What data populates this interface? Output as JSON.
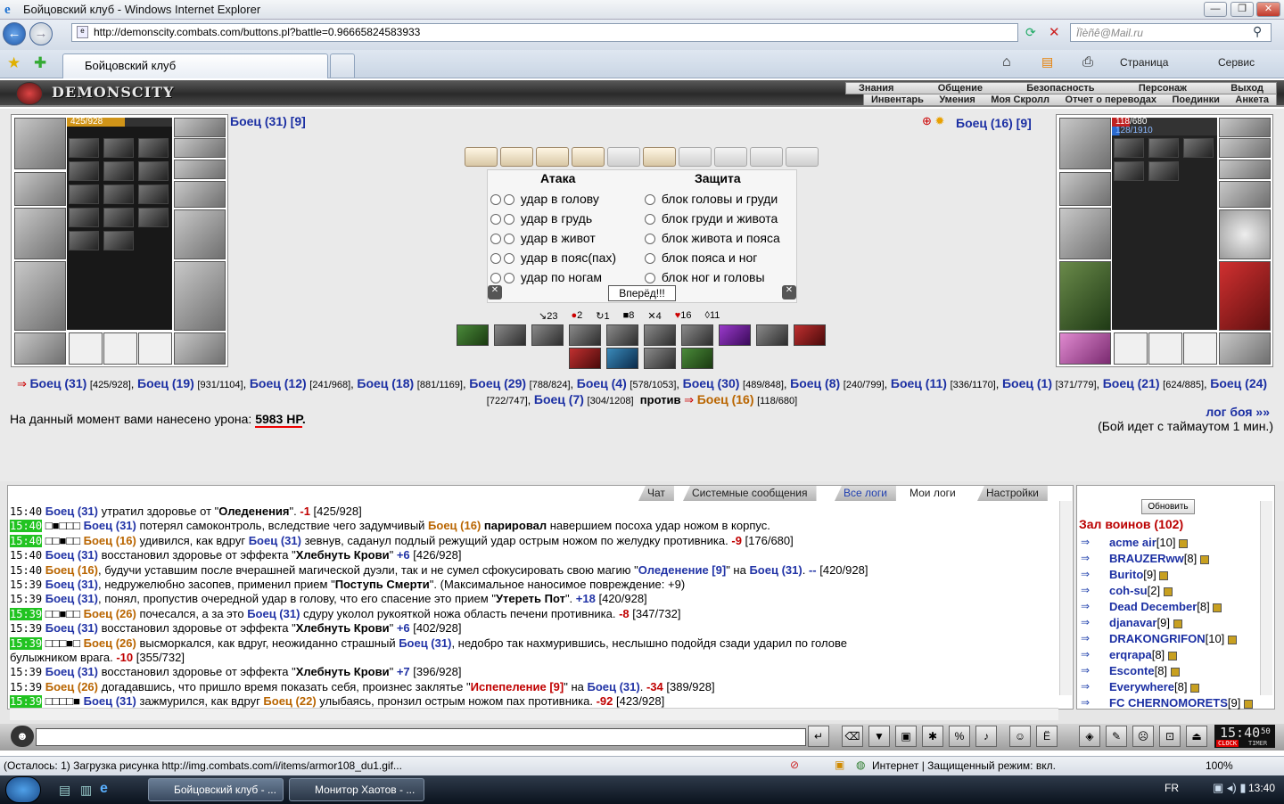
{
  "window": {
    "title": "Бойцовский клуб - Windows Internet Explorer"
  },
  "browser": {
    "url": "http://demonscity.combats.com/buttons.pl?battle=0.96665824583933",
    "search_placeholder": "Ïîèñê@Mail.ru",
    "tab_title": "Бойцовский клуб",
    "page_label": "Страница",
    "service_label": "Сервис"
  },
  "game": {
    "logo": "DEMONSCITY",
    "menu_row1": [
      "Знания",
      "Общение",
      "Безопасность",
      "Персонаж",
      "Выход"
    ],
    "menu_row2": [
      "Инвентарь",
      "Умения",
      "Моя Скролл",
      "Отчет о переводах",
      "Поединки",
      "Анкета"
    ],
    "left_fighter": {
      "name": "Боец (31) [9]",
      "hp": "425/928"
    },
    "right_fighter": {
      "name": "Боец (16) [9]",
      "hp": "118/680",
      "mana": "128/1910"
    },
    "attack_title": "Атака",
    "defense_title": "Защита",
    "attacks": [
      "удар в голову",
      "удар в грудь",
      "удар в живот",
      "удар в пояс(пах)",
      "удар по ногам"
    ],
    "blocks": [
      "блок головы и груди",
      "блок груди и живота",
      "блок живота и пояса",
      "блок пояса и ног",
      "блок ног и головы"
    ],
    "forward_button": "Вперёд!!!",
    "stats": [
      "23",
      "2",
      "1",
      "8",
      "4",
      "16",
      "11"
    ],
    "team_line1": [
      {
        "n": "Боец (31)",
        "v": "[425/928]"
      },
      {
        "n": "Боец (19)",
        "v": "[931/1104]"
      },
      {
        "n": "Боец (12)",
        "v": "[241/968]"
      },
      {
        "n": "Боец (18)",
        "v": "[881/1169]"
      },
      {
        "n": "Боец (29)",
        "v": "[788/824]"
      },
      {
        "n": "Боец (4)",
        "v": "[578/1053]"
      },
      {
        "n": "Боец (30)",
        "v": "[489/848]"
      },
      {
        "n": "Боец (8)",
        "v": "[240/799]"
      },
      {
        "n": "Боец (11)",
        "v": "[336/1170]"
      }
    ],
    "team_line2": [
      {
        "n": "Боец (1)",
        "v": "[371/779]"
      },
      {
        "n": "Боец (21)",
        "v": "[624/885]"
      },
      {
        "n": "Боец (24)",
        "v": "[722/747]"
      },
      {
        "n": "Боец (7)",
        "v": "[304/1208]"
      }
    ],
    "versus": "против",
    "enemy": {
      "n": "Боец (16)",
      "v": "[118/680]"
    },
    "damage_label": "На данный момент вами нанесено урона:",
    "damage_value": "5983 HP",
    "log_link": "лог боя »»",
    "timeout_text": "(Бой идет с таймаутом 1 мин.)"
  },
  "log_tabs": [
    "Чат",
    "Системные сообщения",
    "Все логи",
    "Мои логи",
    "Настройки"
  ],
  "log": [
    {
      "t": "15:40",
      "g": false,
      "html": "<span class='blue'>Боец (31)</span> утратил здоровье от \"<b>Оледенения</b>\". <span class='red'>-1</span> [425/928]"
    },
    {
      "t": "15:40",
      "g": true,
      "html": "□<b>■</b>□□□ <span class='blue'>Боец (31)</span> потерял самоконтроль, вследствие чего задумчивый <span class='orange'>Боец (16)</span> <b>парировал</b> навершием посоха удар ножом в корпус."
    },
    {
      "t": "15:40",
      "g": true,
      "html": "□□■□□ <span class='orange'>Боец (16)</span> удивился, как вдруг <span class='blue'>Боец (31)</span> зевнув, саданул подлый режущий удар острым ножом по желудку противника. <span class='red'>-9</span> [176/680]"
    },
    {
      "t": "15:40",
      "g": false,
      "html": "<span class='blue'>Боец (31)</span> восстановил здоровье от эффекта \"<b>Хлебнуть Крови</b>\" <span class='blue'>+6</span> [426/928]"
    },
    {
      "t": "15:40",
      "g": false,
      "html": "<span class='orange'>Боец (16)</span>, будучи уставшим после вчерашней магической дуэли, так и не сумел сфокусировать свою магию \"<span class='blue'>Оледенение [9]</span>\" на <span class='blue'>Боец (31)</span>. <span class='blue'>--</span> [420/928]"
    },
    {
      "t": "15:39",
      "g": false,
      "html": "<span class='blue'>Боец (31)</span>, недружелюбно засопев, применил прием \"<b>Поступь Смерти</b>\". (Максимальное наносимое повреждение: +9)"
    },
    {
      "t": "15:39",
      "g": false,
      "html": "<span class='blue'>Боец (31)</span>, понял, пропустив очередной удар в голову, что его спасение это прием \"<b>Утереть Пот</b>\". <span class='blue'>+18</span> [420/928]"
    },
    {
      "t": "15:39",
      "g": true,
      "html": "□□■□□ <span class='orange'>Боец (26)</span> почесался, а за это <span class='blue'>Боец (31)</span> сдуру уколол рукояткой ножа область печени противника. <span class='red'>-8</span> [347/732]"
    },
    {
      "t": "15:39",
      "g": false,
      "html": "<span class='blue'>Боец (31)</span> восстановил здоровье от эффекта \"<b>Хлебнуть Крови</b>\" <span class='blue'>+6</span> [402/928]"
    },
    {
      "t": "15:39",
      "g": true,
      "html": "□□□■□ <span class='orange'>Боец (26)</span> высморкался, как вдруг, неожиданно страшный <span class='blue'>Боец (31)</span>, недобро так нахмурившись, неслышно подойдя сзади ударил по голове"
    },
    {
      "t": "",
      "g": false,
      "html": "булыжником врага. <span class='red'>-10</span> [355/732]"
    },
    {
      "t": "15:39",
      "g": false,
      "html": "<span class='blue'>Боец (31)</span> восстановил здоровье от эффекта \"<b>Хлебнуть Крови</b>\" <span class='blue'>+7</span> [396/928]"
    },
    {
      "t": "15:39",
      "g": false,
      "html": "<span class='orange'>Боец (26)</span> догадавшись, что пришло время показать себя, произнес заклятье \"<span class='red'>Испепеление [9]</span>\" на <span class='blue'>Боец (31)</span>. <span class='red'>-34</span> [389/928]"
    },
    {
      "t": "15:39",
      "g": true,
      "html": "□□□□■ <span class='blue'>Боец (31)</span> зажмурился, как вдруг <span class='orange'>Боец (22)</span> улыбаясь, пронзил острым ножом пах противника. <span class='red'>-92</span> [423/928]"
    }
  ],
  "users": {
    "refresh": "Обновить",
    "hall": "Зал воинов (102)",
    "list": [
      {
        "n": "acme air",
        "l": "[10]"
      },
      {
        "n": "BRAUZERww",
        "l": "[8]"
      },
      {
        "n": "Burito",
        "l": "[9]"
      },
      {
        "n": "coh-su",
        "l": "[2]"
      },
      {
        "n": "Dead December",
        "l": "[8]"
      },
      {
        "n": "djanavar",
        "l": "[9]"
      },
      {
        "n": "DRAKONGRIFON",
        "l": "[10]"
      },
      {
        "n": "erqrapa",
        "l": "[8]"
      },
      {
        "n": "Esconte",
        "l": "[8]"
      },
      {
        "n": "Everywhere",
        "l": "[8]"
      },
      {
        "n": "FC CHERNOMORETS",
        "l": "[9]"
      }
    ]
  },
  "clock": {
    "time": "15:40",
    "sec": "50",
    "label": "CLOCK",
    "timer": "TIMER"
  },
  "status": {
    "text": "(Осталось: 1) Загрузка рисунка http://img.combats.com/i/items/armor108_du1.gif...",
    "zone": "Интернет | Защищенный режим: вкл.",
    "zoom": "100%"
  },
  "taskbar": {
    "tasks": [
      "Бойцовский клуб - ...",
      "Монитор Хаотов - ..."
    ],
    "lang": "FR",
    "time": "13:40"
  }
}
